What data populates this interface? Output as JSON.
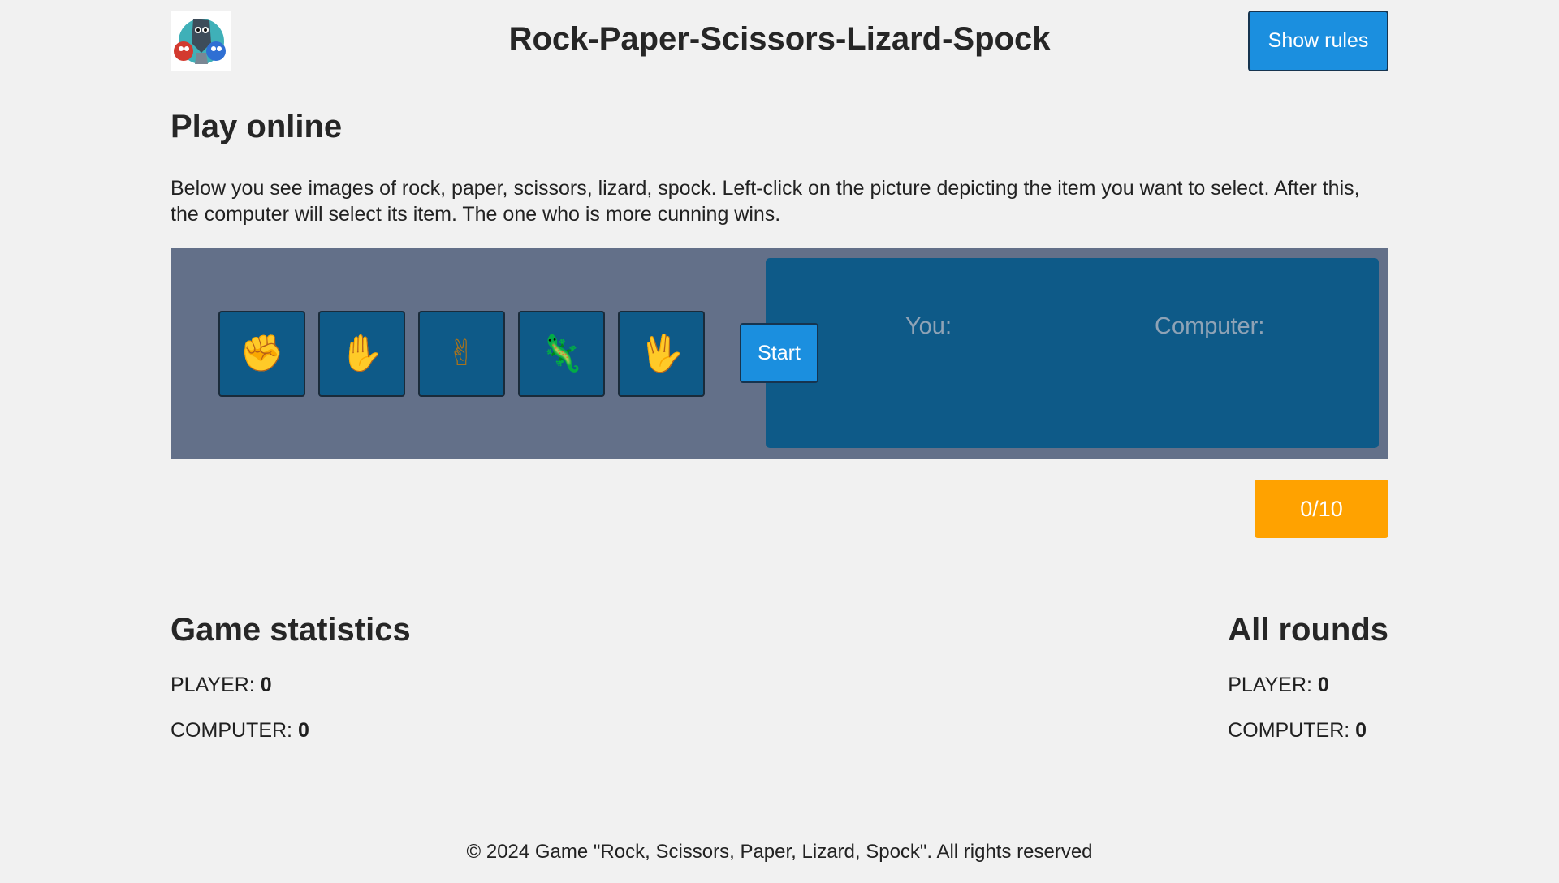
{
  "header": {
    "title": "Rock-Paper-Scissors-Lizard-Spock",
    "rules_button": "Show rules",
    "logo_icon": "game-mascot-logo"
  },
  "play": {
    "heading": "Play online",
    "intro": "Below you see images of rock, paper, scissors, lizard, spock. Left-click on the picture depicting the item you want to select. After this, the computer will select its item. The one who is more cunning wins."
  },
  "game": {
    "choices": [
      {
        "name": "rock",
        "icon": "fist-icon",
        "glyph": "✊"
      },
      {
        "name": "paper",
        "icon": "raised-hand-icon",
        "glyph": "✋"
      },
      {
        "name": "scissors",
        "icon": "victory-hand-icon",
        "glyph": "✌"
      },
      {
        "name": "lizard",
        "icon": "lizard-icon",
        "glyph": "🦎"
      },
      {
        "name": "spock",
        "icon": "vulcan-salute-icon",
        "glyph": "🖖"
      }
    ],
    "start_button": "Start",
    "you_label": "You:",
    "computer_label": "Computer:"
  },
  "round_counter": "0/10",
  "game_statistics": {
    "heading": "Game statistics",
    "player_label": "PLAYER:",
    "player_score": "0",
    "computer_label": "COMPUTER:",
    "computer_score": "0"
  },
  "all_rounds": {
    "heading": "All rounds",
    "player_label": "PLAYER:",
    "player_score": "0",
    "computer_label": "COMPUTER:",
    "computer_score": "0"
  },
  "footer": "© 2024 Game \"Rock, Scissors, Paper, Lizard, Spock\". All rights reserved",
  "colors": {
    "accent_button": "#1b8fdf",
    "panel": "#637089",
    "tile": "#0e5a88",
    "counter": "#ffa200"
  }
}
